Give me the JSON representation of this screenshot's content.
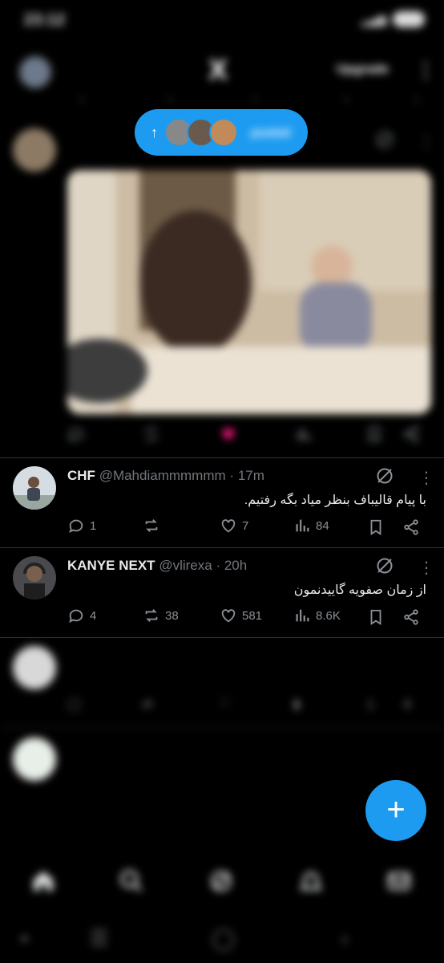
{
  "status_bar": {
    "time": "23:12",
    "battery": ""
  },
  "top_nav": {
    "logo": "X",
    "upgrade_label": "Upgrade"
  },
  "posted_pill": {
    "label": "posted"
  },
  "tweets": [
    {
      "name": "",
      "handle": "",
      "text": "",
      "replies": "",
      "reposts": "",
      "likes": "",
      "views": ""
    },
    {
      "name": "CHF",
      "handle": "@Mahdiammmmmm",
      "sep": "·",
      "time": "17m",
      "text": "با پیام قالیباف بنظر میاد بگه رفتیم.",
      "replies": "1",
      "reposts": "",
      "likes": "7",
      "views": "84"
    },
    {
      "name": "KANYE NEXT",
      "handle": "@vlirexa",
      "sep": "·",
      "time": "20h",
      "text": "از زمان صفویه گاییدنمون",
      "replies": "4",
      "reposts": "38",
      "likes": "581",
      "views": "8.6K"
    },
    {
      "name": "",
      "handle": "",
      "text": "",
      "replies": "",
      "reposts": "",
      "likes": "",
      "views": ""
    },
    {
      "name": "",
      "handle": "",
      "text": "",
      "line2": ""
    }
  ],
  "fab": {
    "label": "+"
  },
  "colors": {
    "accent": "#1d9bf0",
    "like_active": "#f91880",
    "background": "#000000",
    "muted": "#71767b"
  },
  "icons": [
    "home-icon",
    "search-icon",
    "grok-icon",
    "notifications-icon",
    "messages-icon",
    "reply-icon",
    "repost-icon",
    "like-icon",
    "views-icon",
    "bookmark-icon",
    "share-icon",
    "more-icon"
  ]
}
